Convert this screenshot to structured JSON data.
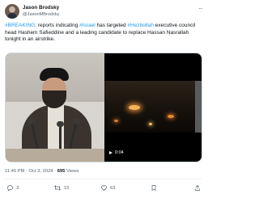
{
  "author": {
    "name": "Jason Brodsky",
    "handle": "@JasonMBrodsky"
  },
  "more_label": "···",
  "tweet": {
    "t1": "#BREAKING",
    "t2": ": reports indicating ",
    "t3": "#Israel",
    "t4": " has targeted ",
    "t5": "#Hezbollah",
    "t6": " executive council head Hashem Safieddine and a leading candidate to replace Hassan Nasrallah tonight in an airstrike."
  },
  "video": {
    "time": "0:04"
  },
  "meta": {
    "time": "11:45 PM",
    "sep1": " · ",
    "date": "Oct 3, 2024",
    "sep2": " · ",
    "views": "695",
    "views_label": " Views"
  },
  "actions": {
    "replies": "3",
    "reposts": "15",
    "likes": "63"
  },
  "colors": {
    "accent": "#1d9bf0",
    "text": "#0f1419",
    "muted": "#536471"
  }
}
